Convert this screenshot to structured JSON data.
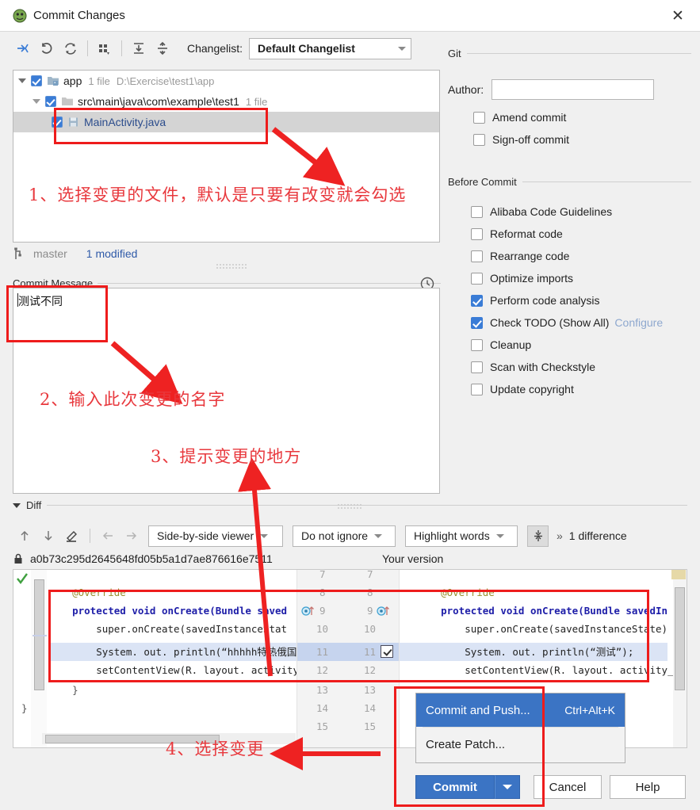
{
  "window": {
    "title": "Commit Changes",
    "close_label": "✕",
    "icon": "idea-app-icon"
  },
  "toolbar": {
    "icons": [
      "collapse-selection-icon",
      "revert-icon",
      "refresh-icon",
      "group-by-icon",
      "expand-all-icon",
      "collapse-all-icon"
    ],
    "changelist_label": "Changelist:",
    "changelist_value": "Default Changelist"
  },
  "file_tree": {
    "rows": [
      {
        "name": "app",
        "files": "1 file",
        "path": "D:\\Exercise\\test1\\app",
        "checked": true,
        "icon": "module-icon",
        "level": 1
      },
      {
        "name": "src\\main\\java\\com\\example\\test1",
        "files": "1 file",
        "path": "",
        "checked": true,
        "icon": "folder-icon",
        "level": 2
      },
      {
        "name": "MainActivity.java",
        "files": "",
        "path": "",
        "checked": true,
        "icon": "java-file-icon",
        "level": 3
      }
    ]
  },
  "status_bar": {
    "branch": "master",
    "modified": "1 modified",
    "branch_icon": "branch-icon"
  },
  "commit_message": {
    "group_label": "Commit Message",
    "value": "测试不同",
    "history_icon": "clock-icon"
  },
  "git_panel": {
    "group_label": "Git",
    "author_label": "Author:",
    "author_value": "",
    "checkboxes": [
      {
        "label": "Amend commit",
        "checked": false,
        "mnemonic_index": 1
      },
      {
        "label": "Sign-off commit",
        "checked": false,
        "mnemonic_index": 3
      }
    ]
  },
  "before_commit": {
    "group_label": "Before Commit",
    "checkboxes": [
      {
        "label": "Alibaba Code Guidelines",
        "checked": false
      },
      {
        "label": "Reformat code",
        "checked": false
      },
      {
        "label": "Rearrange code",
        "checked": false
      },
      {
        "label": "Optimize imports",
        "checked": false
      },
      {
        "label": "Perform code analysis",
        "checked": true
      },
      {
        "label": "Check TODO (Show All)",
        "checked": true,
        "link": "Configure"
      },
      {
        "label": "Cleanup",
        "checked": false
      },
      {
        "label": "Scan with Checkstyle",
        "checked": false
      },
      {
        "label": "Update copyright",
        "checked": false
      }
    ]
  },
  "diff": {
    "group_label": "Diff",
    "toolbar": {
      "icons": [
        "prev-difference-icon",
        "next-difference-icon",
        "edit-icon",
        "apply-left-icon",
        "apply-right-icon"
      ],
      "viewer_mode": "Side-by-side viewer",
      "whitespace": "Do not ignore",
      "highlight": "Highlight words",
      "collapse_icon": "collapse-unchanged-icon",
      "more_icon": "more-chevrons-icon",
      "difference_count": "1 difference"
    },
    "left_title": "a0b73c295d2645648fd05b5a1d7ae876616e7511",
    "left_title_icon": "lock-icon",
    "right_title": "Your version",
    "ok_icon": "green-check-icon",
    "left_lines": [
      "    @Override",
      "    protected void onCreate(Bundle saved",
      "        super.onCreate(savedInstanceStat",
      "        System. out. println(“hhhhh特热俄国",
      "        setContentView(R. layout. activity_",
      "    }",
      "}"
    ],
    "right_lines": [
      "    @Override",
      "    protected void onCreate(Bundle savedIn",
      "        super.onCreate(savedInstanceState)",
      "        System. out. println(“测试”);",
      "        setContentView(R. layout. activity_m",
      "    }",
      "}"
    ],
    "line_numbers_left": [
      "7",
      "8",
      "9",
      "10",
      "11",
      "12",
      "13",
      "14",
      "15"
    ],
    "line_numbers_right": [
      "7",
      "8",
      "9",
      "10",
      "11",
      "12",
      "13",
      "14",
      "15"
    ],
    "changed_line": "11",
    "accept_change_icon": "accept-change-checkbox"
  },
  "popup_menu": {
    "items": [
      {
        "label": "Commit and Push...",
        "shortcut": "Ctrl+Alt+K",
        "selected": true
      },
      {
        "label": "Create Patch...",
        "shortcut": "",
        "selected": false
      }
    ]
  },
  "buttons": {
    "commit": "Commit",
    "commit_dropdown_icon": "chevron-down-icon",
    "cancel": "Cancel",
    "help": "Help"
  },
  "annotations": [
    {
      "id": "a1",
      "text": "1、选择变更的文件，默认是只要有改变就会勾选"
    },
    {
      "id": "a2",
      "text": "2、输入此次变更的名字"
    },
    {
      "id": "a3",
      "text": "3、提示变更的地方"
    },
    {
      "id": "a4",
      "text": "4、选择变更"
    }
  ],
  "colors": {
    "accent": "#3b74c4",
    "annotation_red": "#ee1c1c",
    "annotation_text": "#e8383d",
    "link": "#8ea8cf"
  }
}
